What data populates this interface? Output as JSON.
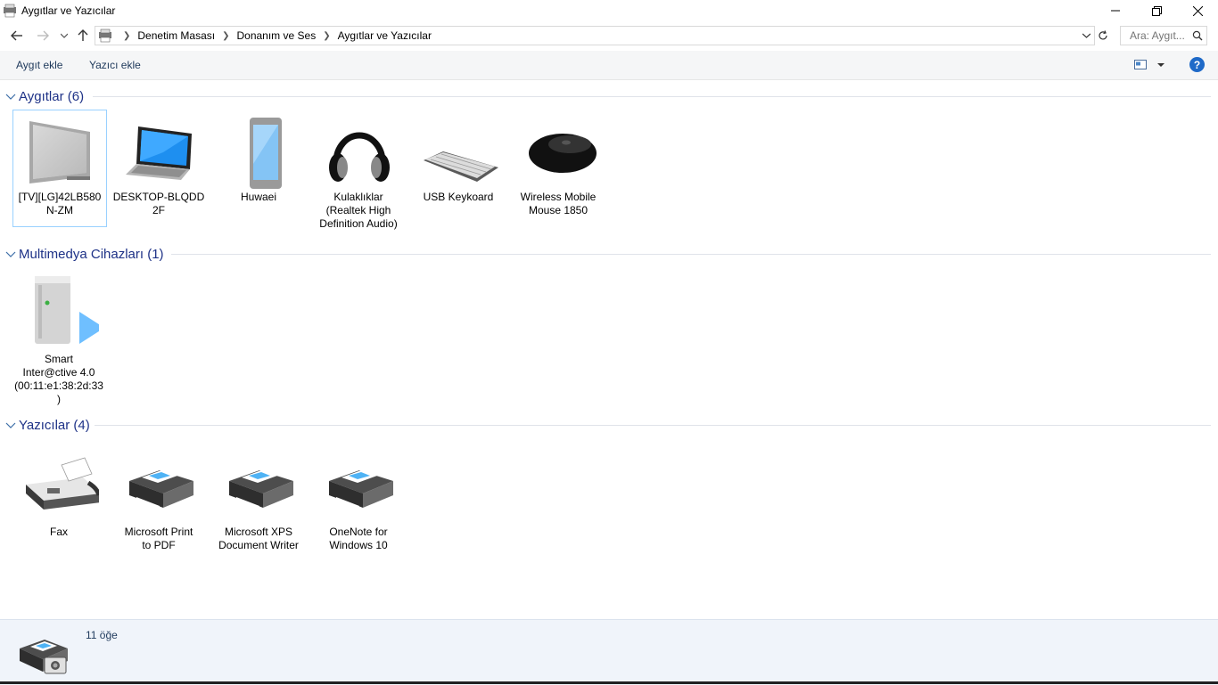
{
  "window": {
    "title": "Aygıtlar ve Yazıcılar"
  },
  "address": {
    "crumbs": [
      "Denetim Masası",
      "Donanım ve Ses",
      "Aygıtlar ve Yazıcılar"
    ]
  },
  "search": {
    "placeholder": "Ara: Aygıt..."
  },
  "commands": {
    "add_device": "Aygıt ekle",
    "add_printer": "Yazıcı ekle",
    "help": "?"
  },
  "groups": {
    "devices": {
      "title": "Aygıtlar (6)",
      "items": [
        {
          "line1": "[TV][LG]42LB580",
          "line2": "N-ZM",
          "line3": ""
        },
        {
          "line1": "DESKTOP-BLQDD",
          "line2": "2F",
          "line3": ""
        },
        {
          "line1": "Huwaei",
          "line2": "",
          "line3": ""
        },
        {
          "line1": "Kulaklıklar",
          "line2": "(Realtek High",
          "line3": "Definition Audio)"
        },
        {
          "line1": "USB Keykoard",
          "line2": "",
          "line3": ""
        },
        {
          "line1": "Wireless Mobile",
          "line2": "Mouse 1850",
          "line3": ""
        }
      ]
    },
    "multimedia": {
      "title": "Multimedya Cihazları (1)",
      "items": [
        {
          "line1": "Smart",
          "line2": "Inter@ctive 4.0",
          "line3": "(00:11:e1:38:2d:33",
          "line4": ")"
        }
      ]
    },
    "printers": {
      "title": "Yazıcılar (4)",
      "items": [
        {
          "line1": "Fax",
          "line2": ""
        },
        {
          "line1": "Microsoft Print",
          "line2": "to PDF"
        },
        {
          "line1": "Microsoft XPS",
          "line2": "Document Writer"
        },
        {
          "line1": "OneNote for",
          "line2": "Windows 10"
        }
      ]
    }
  },
  "status": {
    "count": "11 öğe"
  },
  "colors": {
    "group_title": "#1e3287",
    "help_icon": "#1f6ac8",
    "selection_border": "#99d1ff"
  }
}
